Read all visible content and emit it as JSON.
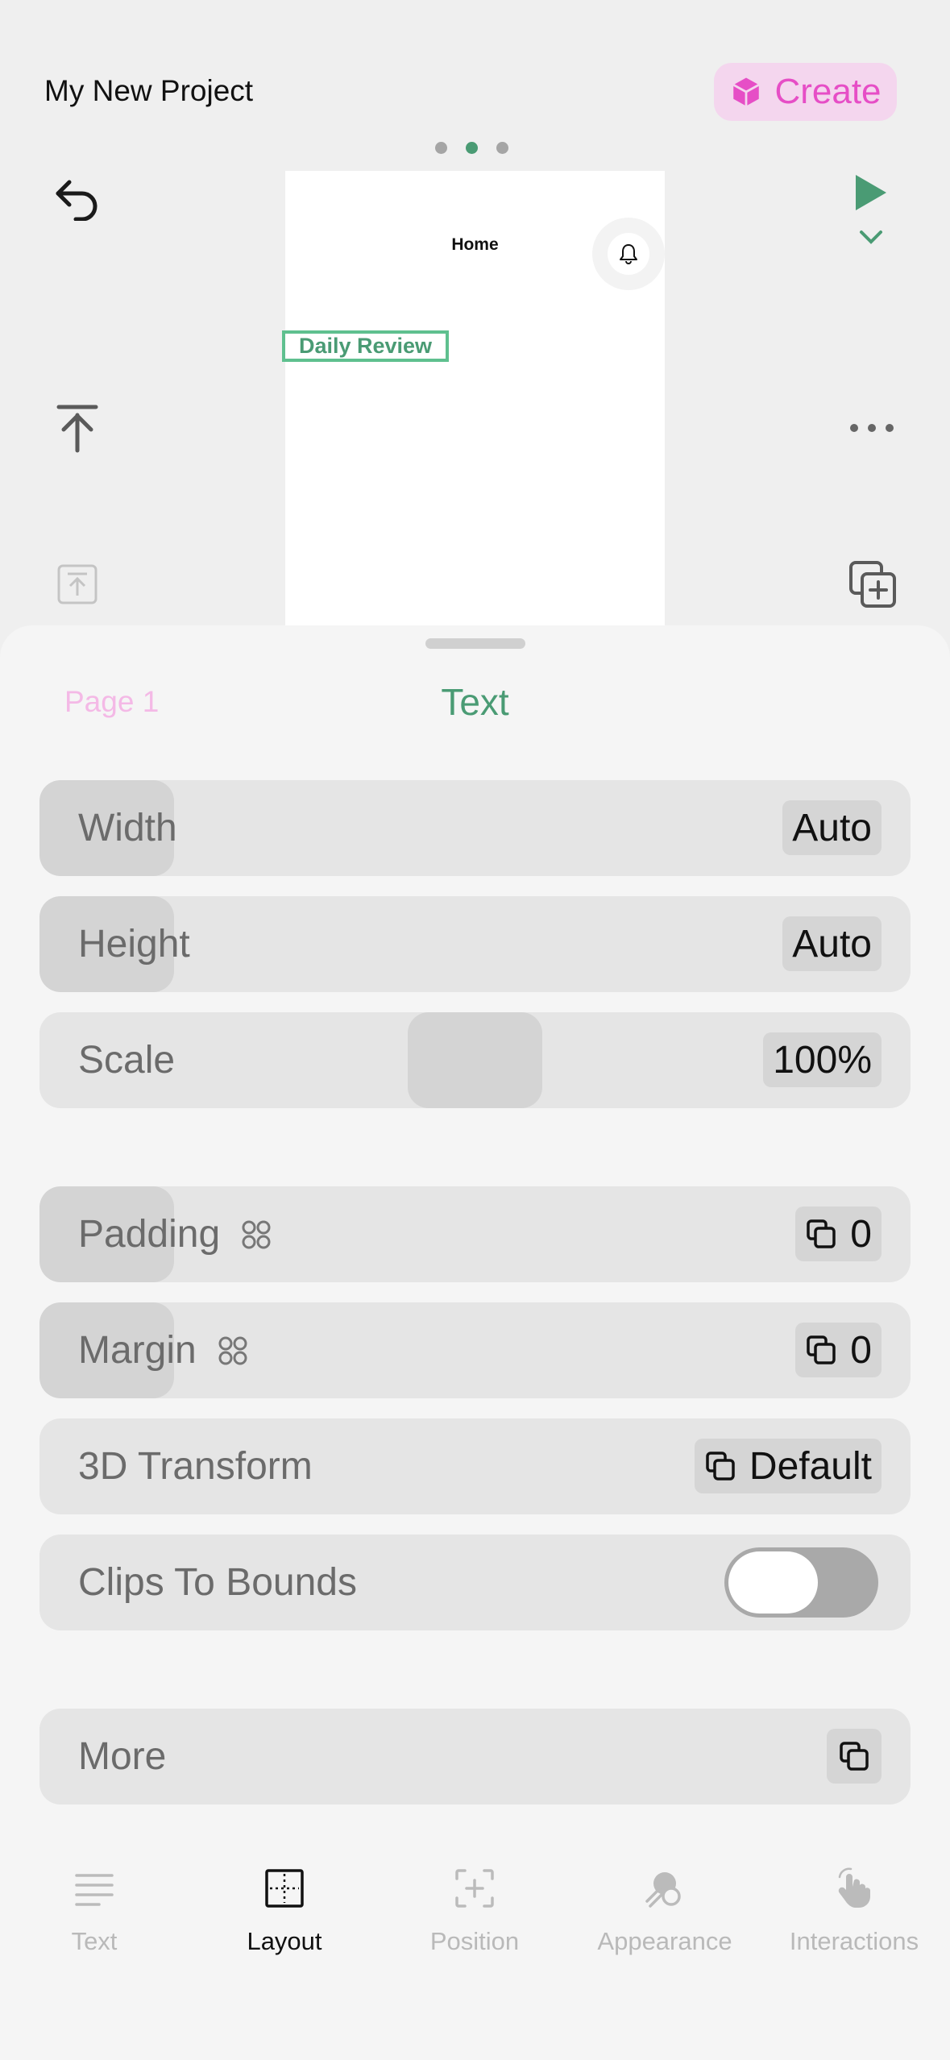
{
  "header": {
    "project_title": "My New Project",
    "create_label": "Create"
  },
  "pager": {
    "count": 3,
    "active_index": 1
  },
  "preview": {
    "nav_title": "Home",
    "selected_text": "Daily Review"
  },
  "sheet": {
    "page_label": "Page 1",
    "title": "Text",
    "rows": {
      "width": {
        "label": "Width",
        "value": "Auto"
      },
      "height": {
        "label": "Height",
        "value": "Auto"
      },
      "scale": {
        "label": "Scale",
        "value": "100%"
      },
      "padding": {
        "label": "Padding",
        "value": "0"
      },
      "margin": {
        "label": "Margin",
        "value": "0"
      },
      "transform": {
        "label": "3D Transform",
        "value": "Default"
      },
      "clips": {
        "label": "Clips To Bounds",
        "enabled": false
      },
      "more": {
        "label": "More"
      }
    }
  },
  "tabs": [
    {
      "label": "Text",
      "icon": "text-lines-icon",
      "active": false
    },
    {
      "label": "Layout",
      "icon": "layout-icon",
      "active": true
    },
    {
      "label": "Position",
      "icon": "position-icon",
      "active": false
    },
    {
      "label": "Appearance",
      "icon": "appearance-icon",
      "active": false
    },
    {
      "label": "Interactions",
      "icon": "hand-tap-icon",
      "active": false
    }
  ],
  "colors": {
    "accent_green": "#4a9b74",
    "create_pink": "#e64ec6",
    "create_bg": "#f4d6ee"
  }
}
